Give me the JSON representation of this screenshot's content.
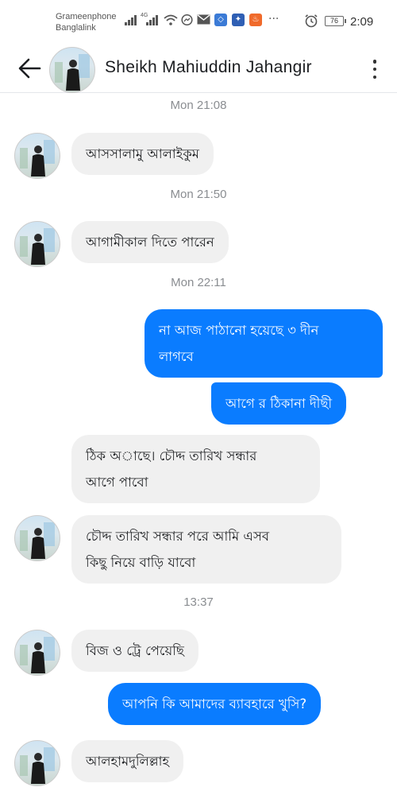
{
  "status_bar": {
    "carrier_1": "Grameenphone",
    "carrier_2": "Banglalink",
    "network_type": "4G",
    "battery": "76",
    "time": "2:09",
    "icons": [
      "signal-icon",
      "wifi-icon",
      "messenger-icon",
      "mail-icon",
      "app-icon",
      "app-icon",
      "fire-icon",
      "more-icon",
      "alarm-icon",
      "battery-icon"
    ]
  },
  "header": {
    "contact_name": "Sheikh Mahiuddin Jahangir",
    "back_icon": "arrow-left-icon",
    "menu_icon": "more-vertical-icon"
  },
  "colors": {
    "outgoing_bubble": "#0a7cff",
    "incoming_bubble": "#f0f0f0",
    "timestamp_text": "#8a8d91"
  },
  "conversation": {
    "timestamps": [
      "Mon 21:08",
      "Mon 21:50",
      "Mon 22:11",
      "13:37"
    ],
    "messages": [
      {
        "direction": "incoming",
        "text": "আসসালামু আলাইকুম"
      },
      {
        "direction": "incoming",
        "text": "আগামীকাল দিতে পারেন"
      },
      {
        "direction": "outgoing",
        "lines": [
          "না আজ পাঠানো হয়েছে ৩ দীন",
          "লাগবে"
        ]
      },
      {
        "direction": "outgoing",
        "text": "আগে র ঠিকানা দীছী"
      },
      {
        "direction": "incoming",
        "lines": [
          "ঠিক অাছে। চৌদ্দ তারিখ সন্ধার",
          "আগে পাবো"
        ]
      },
      {
        "direction": "incoming",
        "lines": [
          "চৌদ্দ তারিখ সন্ধার পরে আমি এসব",
          "কিছু নিয়ে বাড়ি যাবো"
        ]
      },
      {
        "direction": "incoming",
        "text": "বিজ ও ট্রে পেয়েছি"
      },
      {
        "direction": "outgoing",
        "text": "আপনি কি আমাদের ব্যাবহারে খুসি?"
      },
      {
        "direction": "incoming",
        "text": "আলহামদুলিল্লাহ"
      }
    ]
  }
}
